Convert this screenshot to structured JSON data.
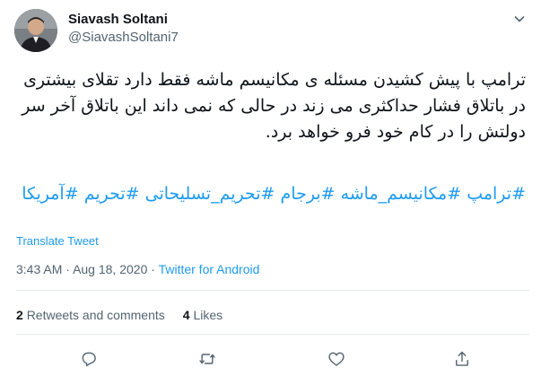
{
  "author": {
    "display_name": "Siavash Soltani",
    "handle": "@SiavashSoltani7"
  },
  "tweet": {
    "text": "ترامپ با پیش کشیدن مسئله ی مکانیسم ماشه فقط دارد تقلای بیشتری در باتلاق فشار حداکثری می زند در حالی که نمی داند این باتلاق آخر سر دولتش را در کام خود فرو خواهد برد.",
    "hashtags": [
      "#ترامپ",
      "#مکانیسم_ماشه",
      "#برجام",
      "#تحریم_تسلیحاتی",
      "#تحریم",
      "#آمریکا"
    ]
  },
  "translate_label": "Translate Tweet",
  "meta": {
    "time": "3:43 AM",
    "separator": "·",
    "date": "Aug 18, 2020",
    "source": "Twitter for Android"
  },
  "stats": {
    "retweets_count": "2",
    "retweets_label": "Retweets and comments",
    "likes_count": "4",
    "likes_label": "Likes"
  },
  "icons": {
    "caret": "chevron-down-icon",
    "reply": "reply-icon",
    "retweet": "retweet-icon",
    "like": "heart-icon",
    "share": "share-icon"
  },
  "colors": {
    "accent": "#1d9bf0",
    "text": "#0f1419",
    "secondary": "#536471",
    "divider": "#e6ecf0"
  }
}
